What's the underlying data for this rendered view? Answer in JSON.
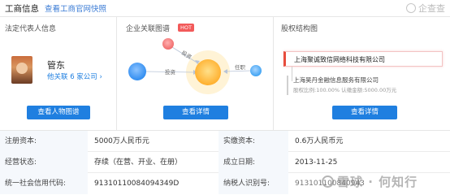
{
  "header": {
    "title": "工商信息",
    "snapshot_link": "查看工商官网快照",
    "brand": "企查查"
  },
  "legal_rep": {
    "section_title": "法定代表人信息",
    "name": "管东",
    "related": "他关联 6 家公司 ›",
    "button": "查看人物图谱"
  },
  "graph": {
    "section_title": "企业关联图谱",
    "hot_badge": "HOT",
    "edge_labels": [
      "投资",
      "投资",
      "任职"
    ],
    "button": "查看详情"
  },
  "equity": {
    "section_title": "股权结构图",
    "top_company": "上海聚诚致信网络科技有限公司",
    "sub_company": "上海昊丹金融信息服务有限公司",
    "sub_detail": "股权比例:100.00% 认缴金额:5000.00万元",
    "button": "查看详情"
  },
  "table": {
    "rows": [
      {
        "k1": "注册资本:",
        "v1": "5000万人民币元",
        "k2": "实缴资本:",
        "v2": "0.6万人民币元"
      },
      {
        "k1": "经营状态:",
        "v1": "存续（在营、开业、在册）",
        "k2": "成立日期:",
        "v2": "2013-11-25"
      },
      {
        "k1": "统一社会信用代码:",
        "v1": "91310110084094349D",
        "k2": "纳税人识别号:",
        "v2": "913101100840943"
      }
    ]
  },
  "watermark": "雪球 · 何知行",
  "colors": {
    "accent": "#1f7fe0",
    "hot": "#f25a5a",
    "graph_center": "#ffb02e",
    "graph_left": "#2f8cf0",
    "graph_top": "#f06a6a",
    "graph_right": "#3da2f3"
  }
}
